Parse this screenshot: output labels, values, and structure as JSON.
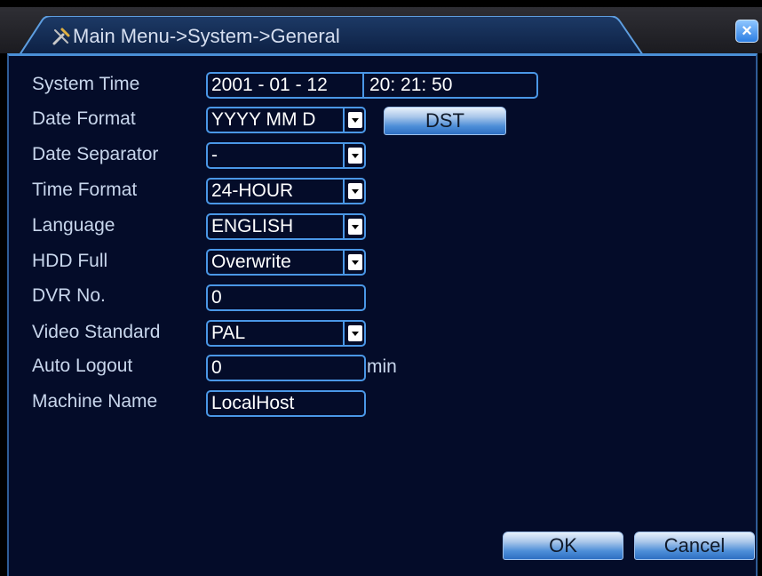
{
  "window": {
    "title": "Main Menu->System->General",
    "close_label": "×"
  },
  "form": {
    "system_time": {
      "label": "System Time",
      "date": "2001 - 01 - 12",
      "time": "20: 21: 50"
    },
    "date_format": {
      "label": "Date Format",
      "value": "YYYY MM D"
    },
    "dst_button": "DST",
    "date_separator": {
      "label": "Date Separator",
      "value": "-"
    },
    "time_format": {
      "label": "Time Format",
      "value": "24-HOUR"
    },
    "language": {
      "label": "Language",
      "value": "ENGLISH"
    },
    "hdd_full": {
      "label": "HDD Full",
      "value": "Overwrite"
    },
    "dvr_no": {
      "label": "DVR No.",
      "value": "0"
    },
    "video_standard": {
      "label": "Video Standard",
      "value": "PAL"
    },
    "auto_logout": {
      "label": "Auto Logout",
      "value": "0",
      "unit": "min"
    },
    "machine_name": {
      "label": "Machine Name",
      "value": "LocalHost"
    }
  },
  "buttons": {
    "ok": "OK",
    "cancel": "Cancel"
  },
  "colors": {
    "panel_bg": "#040c29",
    "field_border": "#4a97e6",
    "accent": "#2d7ee3"
  },
  "icons": {
    "title_icon": "tools-icon",
    "close_icon": "close-icon"
  }
}
